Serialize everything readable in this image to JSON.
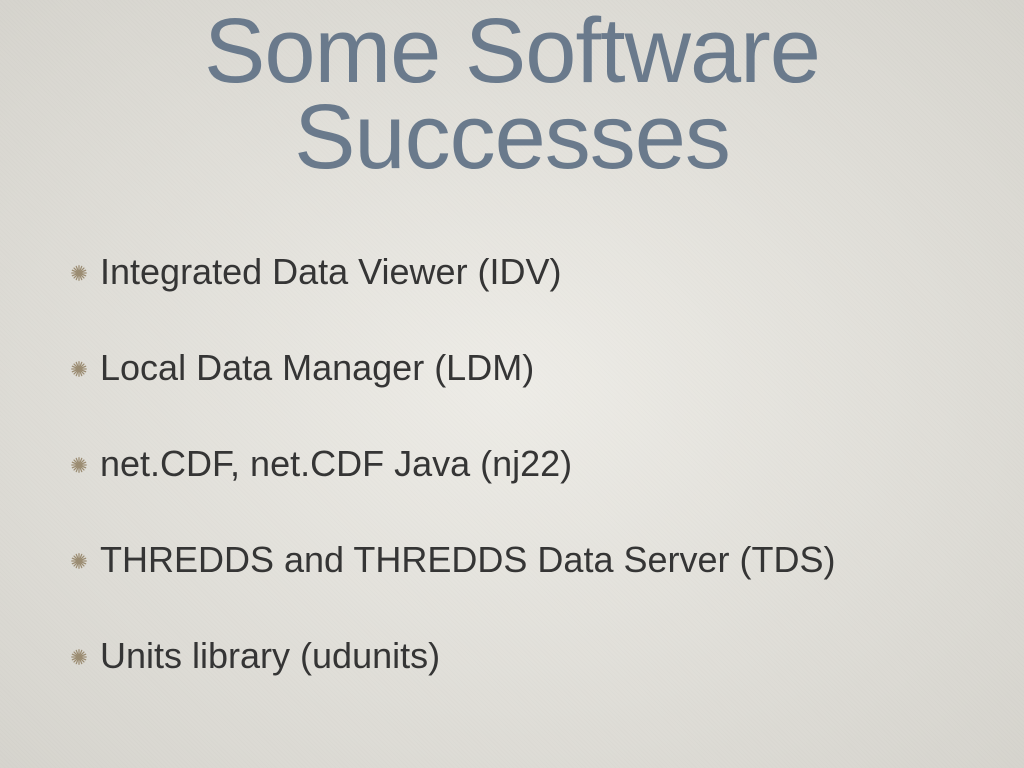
{
  "title": "Some Software Successes",
  "bullets": [
    "Integrated Data Viewer (IDV)",
    "Local Data Manager (LDM)",
    "net.CDF, net.CDF Java (nj22)",
    "THREDDS and THREDDS Data Server (TDS)",
    "Units library (udunits)"
  ]
}
